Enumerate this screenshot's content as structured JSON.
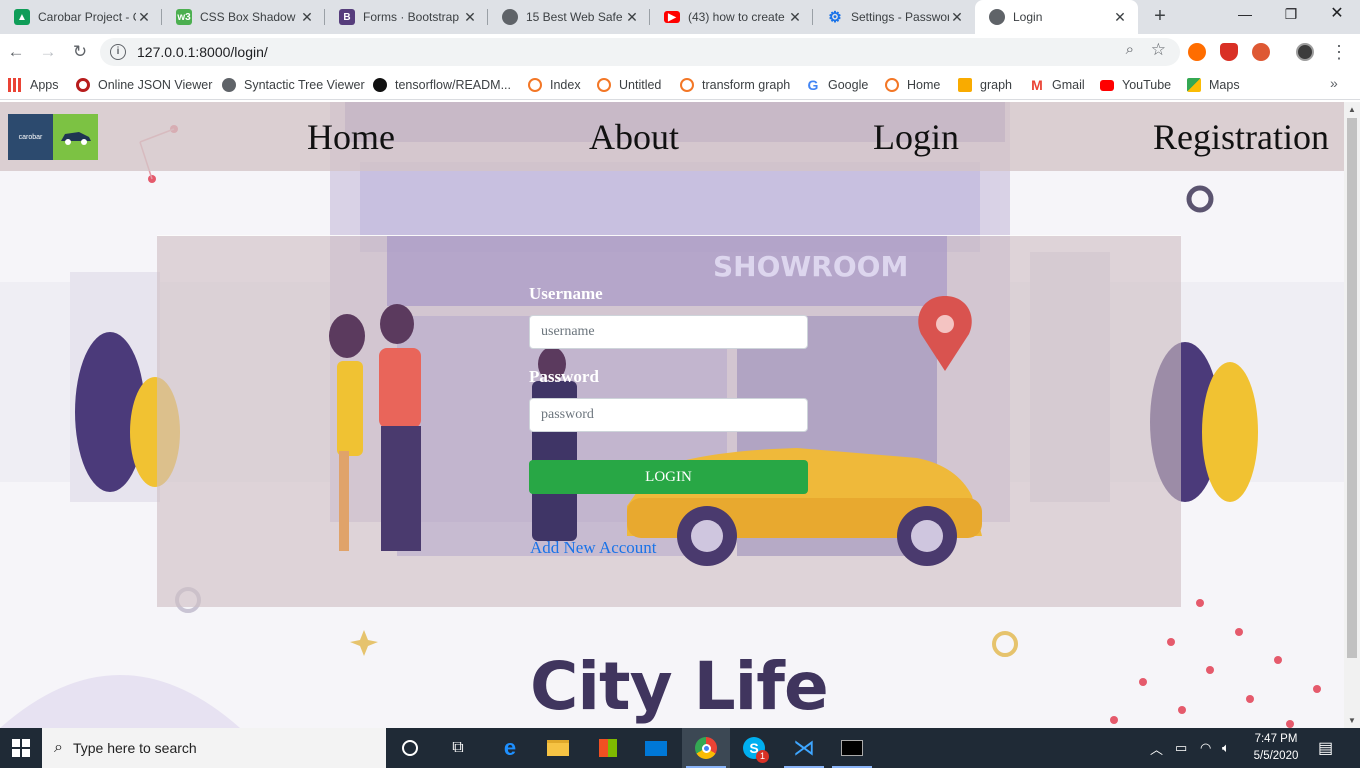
{
  "browser": {
    "tabs": [
      {
        "title": "Carobar Project - G",
        "favicon": "google-drive-icon",
        "color": "#0f9d58"
      },
      {
        "title": "CSS Box Shadow",
        "favicon": "w3schools-icon",
        "color": "#4caf50"
      },
      {
        "title": "Forms · Bootstrap",
        "favicon": "bootstrap-icon",
        "color": "#563d7c"
      },
      {
        "title": "15 Best Web Safe",
        "favicon": "globe-icon",
        "color": "#5f6368"
      },
      {
        "title": "(43) how to create",
        "favicon": "youtube-icon",
        "color": "#ff0000"
      },
      {
        "title": "Settings - Passwor",
        "favicon": "settings-gear-icon",
        "color": "#1a73e8"
      },
      {
        "title": "Login",
        "favicon": "globe-icon",
        "color": "#5f6368"
      }
    ],
    "url": "127.0.0.1:8000/login/",
    "bookmarks": [
      {
        "label": "Apps",
        "icon": "apps-grid-icon",
        "color": "#ea4335"
      },
      {
        "label": "Online JSON Viewer",
        "icon": "json-viewer-icon",
        "color": "#b71c1c"
      },
      {
        "label": "Syntactic Tree Viewer",
        "icon": "globe-icon",
        "color": "#5f6368"
      },
      {
        "label": "tensorflow/READM...",
        "icon": "github-icon",
        "color": "#111111"
      },
      {
        "label": "Index",
        "icon": "jupyter-icon",
        "color": "#f37726"
      },
      {
        "label": "Untitled",
        "icon": "jupyter-icon",
        "color": "#f37726"
      },
      {
        "label": "transform graph",
        "icon": "jupyter-icon",
        "color": "#f37726"
      },
      {
        "label": "Google",
        "icon": "google-icon",
        "color": "#4285f4"
      },
      {
        "label": "Home",
        "icon": "jupyter-icon",
        "color": "#f37726"
      },
      {
        "label": "graph",
        "icon": "notebook-icon",
        "color": "#f9ab00"
      },
      {
        "label": "Gmail",
        "icon": "gmail-icon",
        "color": "#ea4335"
      },
      {
        "label": "YouTube",
        "icon": "youtube-icon",
        "color": "#ff0000"
      },
      {
        "label": "Maps",
        "icon": "maps-icon",
        "color": "#34a853"
      }
    ]
  },
  "site": {
    "logo_text": "carobar",
    "nav": [
      "Home",
      "About",
      "Login",
      "Registration"
    ],
    "form": {
      "username_label": "Username",
      "username_placeholder": "username",
      "password_label": "Password",
      "password_placeholder": "password",
      "login_button": "LOGIN",
      "add_account_link": "Add New Account"
    },
    "background_caption": "City Life",
    "showroom_sign": "SHOWROOM"
  },
  "taskbar": {
    "search_placeholder": "Type here to search",
    "time": "7:47 PM",
    "date": "5/5/2020",
    "skype_badge": "1"
  },
  "colors": {
    "login_button": "#28a745",
    "link": "#1a73e8",
    "nav_bar": "#d4c4c6",
    "taskbar": "#1f2a36"
  }
}
